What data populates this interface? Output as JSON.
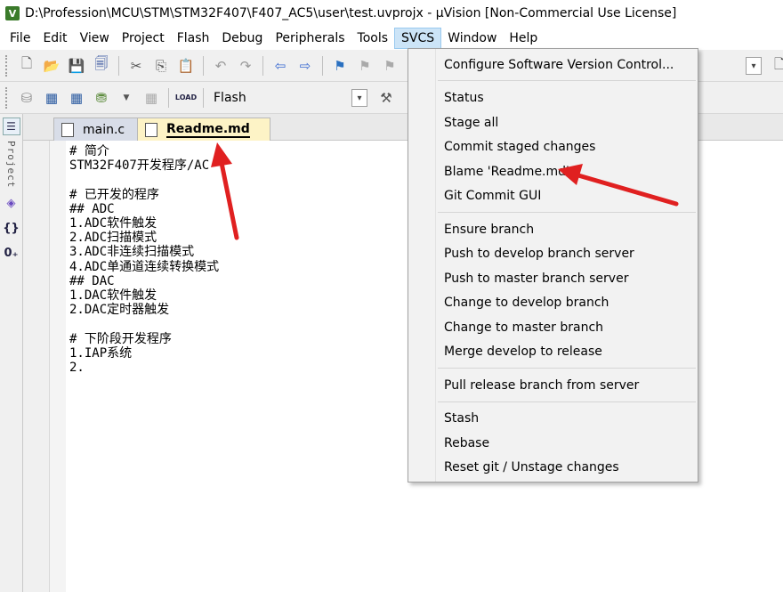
{
  "window": {
    "title": "D:\\Profession\\MCU\\STM\\STM32F407\\F407_AC5\\user\\test.uvprojx - µVision  [Non-Commercial Use License]",
    "app_icon_letter": "V"
  },
  "menubar": {
    "items": [
      "File",
      "Edit",
      "View",
      "Project",
      "Flash",
      "Debug",
      "Peripherals",
      "Tools",
      "SVCS",
      "Window",
      "Help"
    ],
    "active": "SVCS"
  },
  "toolbar2": {
    "target_label": "Flash"
  },
  "leftstrip": {
    "project_label": "Project"
  },
  "tabs": [
    {
      "label": "main.c",
      "active": false
    },
    {
      "label": "Readme.md",
      "active": true
    }
  ],
  "editor": {
    "lines": [
      "# 简介",
      "STM32F407开发程序/AC",
      "",
      "# 已开发的程序",
      "## ADC",
      "1.ADC软件触发",
      "2.ADC扫描模式",
      "3.ADC非连续扫描模式",
      "4.ADC单通道连续转换模式",
      "## DAC",
      "1.DAC软件触发",
      "2.DAC定时器触发",
      "",
      "# 下阶段开发程序",
      "1.IAP系统",
      "2."
    ]
  },
  "svcs_menu": {
    "groups": [
      [
        "Configure Software Version Control..."
      ],
      [
        "Status",
        "Stage all",
        "Commit staged changes",
        "Blame 'Readme.md'",
        "Git Commit GUI"
      ],
      [
        "Ensure branch",
        "Push to develop branch server",
        "Push to master branch server",
        "Change to develop branch",
        "Change to master branch",
        "Merge develop to release"
      ],
      [
        "Pull release branch  from server"
      ],
      [
        "Stash",
        "Rebase",
        "Reset git / Unstage changes"
      ]
    ]
  },
  "colors": {
    "annotation_arrow": "#e02020",
    "active_tab": "#fdf3c6",
    "menu_highlight": "#cce4f7"
  }
}
